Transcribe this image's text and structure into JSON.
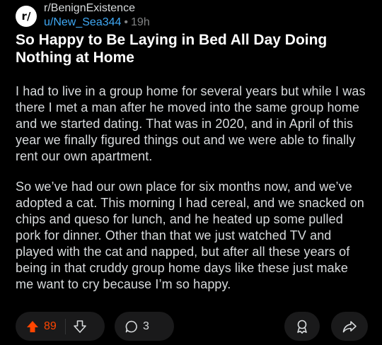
{
  "header": {
    "subreddit_icon": "r/",
    "subreddit": "r/BenignExistence",
    "username": "u/New_Sea344",
    "separator": "•",
    "age": "19h"
  },
  "post": {
    "title": "So Happy to Be Laying in Bed All Day Doing Nothing at Home",
    "paragraphs": [
      "I had to live in a group home for several years but while I was there I met a man after he moved into the same group home and we started dating. That was in 2020, and in April of this year we finally figured things out and we were able to finally rent our own apartment.",
      "So we’ve had our own place for six months now, and we’ve adopted a cat. This morning I had cereal, and we snacked on chips and queso for lunch, and he heated up some pulled pork for dinner. Other than that we just watched TV and played with the cat and napped, but after all these years of being in that cruddy group home days like these just make me want to cry because I’m so happy."
    ]
  },
  "actions": {
    "upvotes": "89",
    "comments": "3",
    "icons": [
      "upvote-icon",
      "downvote-icon",
      "comment-icon",
      "award-icon",
      "share-icon"
    ]
  },
  "colors": {
    "background": "#000000",
    "text": "#d7dadc",
    "title": "#ffffff",
    "username": "#3fa8f4",
    "upvote": "#ff4500",
    "pill": "#1a1a1b"
  }
}
